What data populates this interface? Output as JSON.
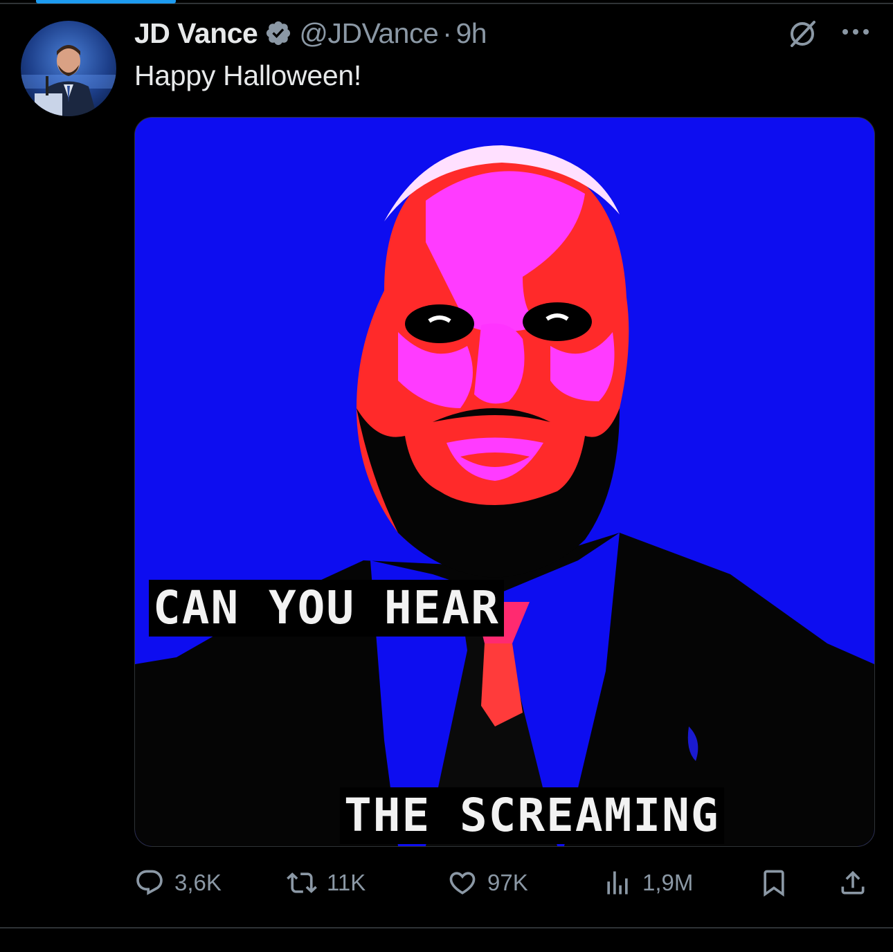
{
  "post": {
    "author": {
      "display_name": "JD Vance",
      "verified": true,
      "handle": "@JDVance",
      "separator": "·",
      "time": "9h"
    },
    "text": "Happy Halloween!",
    "media": {
      "caption_line_1": "CAN YOU HEAR",
      "caption_line_2": "THE SCREAMING"
    },
    "actions": {
      "replies": "3,6K",
      "reposts": "11K",
      "likes": "97K",
      "views": "1,9M"
    }
  },
  "icons": {
    "header": [
      "grok-icon",
      "more-options-icon",
      "verified-badge-icon"
    ],
    "actions": [
      "reply-icon",
      "repost-icon",
      "like-icon",
      "views-icon",
      "bookmark-icon",
      "share-icon"
    ]
  },
  "colors": {
    "background": "#000000",
    "text_primary": "#e7e9ea",
    "text_secondary": "#8b98a5",
    "accent": "#1d9bf0",
    "media_blue": "#0d0df0",
    "media_magenta": "#ff33ff",
    "media_red": "#ff2a2a"
  }
}
